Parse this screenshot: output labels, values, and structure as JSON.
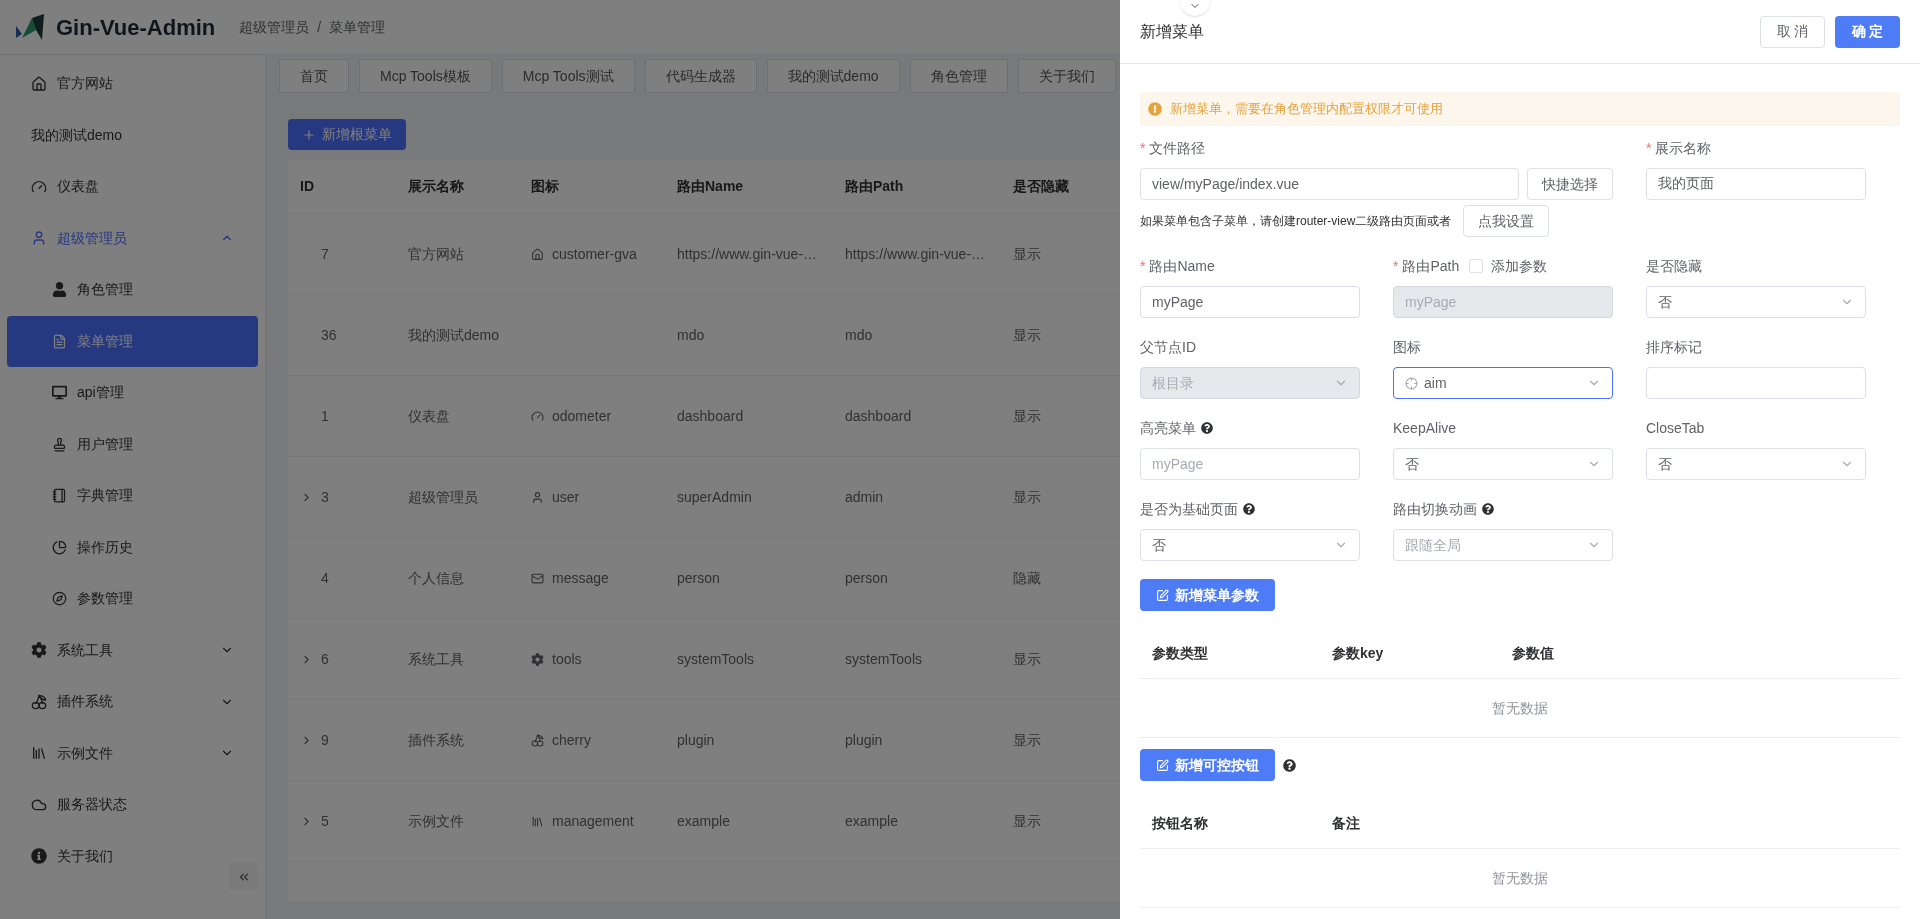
{
  "header": {
    "logo_text": "Gin-Vue-Admin",
    "breadcrumb": [
      "超级管理员",
      "菜单管理"
    ],
    "separator": "/"
  },
  "sidebar": {
    "items": [
      {
        "label": "官方网站",
        "selected": false
      },
      {
        "label": "我的测试demo",
        "selected": false
      },
      {
        "label": "仪表盘",
        "selected": false
      },
      {
        "label": "超级管理员",
        "selected": false,
        "expanded": true,
        "children": [
          {
            "label": "角色管理",
            "selected": false
          },
          {
            "label": "菜单管理",
            "selected": true
          },
          {
            "label": "api管理",
            "selected": false
          },
          {
            "label": "用户管理",
            "selected": false
          },
          {
            "label": "字典管理",
            "selected": false
          },
          {
            "label": "操作历史",
            "selected": false
          },
          {
            "label": "参数管理",
            "selected": false
          }
        ]
      },
      {
        "label": "系统工具",
        "selected": false,
        "expanded": false
      },
      {
        "label": "插件系统",
        "selected": false,
        "expanded": false
      },
      {
        "label": "示例文件",
        "selected": false,
        "expanded": false
      },
      {
        "label": "服务器状态",
        "selected": false
      },
      {
        "label": "关于我们",
        "selected": false
      }
    ]
  },
  "tabs": [
    {
      "label": "首页",
      "selected": false
    },
    {
      "label": "Mcp Tools模板",
      "selected": false
    },
    {
      "label": "Mcp Tools测试",
      "selected": false
    },
    {
      "label": "代码生成器",
      "selected": false
    },
    {
      "label": "我的测试demo",
      "selected": false
    },
    {
      "label": "角色管理",
      "selected": false
    },
    {
      "label": "关于我们",
      "selected": false
    }
  ],
  "add_root_button": "新增根菜单",
  "table": {
    "columns": [
      "ID",
      "展示名称",
      "图标",
      "路由Name",
      "路由Path",
      "是否隐藏"
    ],
    "rows": [
      {
        "has_children": false,
        "id": "7",
        "name": "官方网站",
        "icon_name": "customer-gva",
        "route_name": "https://www.gin-vue-…",
        "route_path": "https://www.gin-vue-…",
        "hidden": "显示"
      },
      {
        "has_children": false,
        "id": "36",
        "name": "我的测试demo",
        "route_name": "mdo",
        "route_path": "mdo",
        "hidden": "显示"
      },
      {
        "has_children": false,
        "id": "1",
        "name": "仪表盘",
        "icon_name": "odometer",
        "route_name": "dashboard",
        "route_path": "dashboard",
        "hidden": "显示"
      },
      {
        "has_children": true,
        "id": "3",
        "name": "超级管理员",
        "icon_name": "user",
        "route_name": "superAdmin",
        "route_path": "admin",
        "hidden": "显示"
      },
      {
        "has_children": false,
        "id": "4",
        "name": "个人信息",
        "icon_name": "message",
        "route_name": "person",
        "route_path": "person",
        "hidden": "隐藏"
      },
      {
        "has_children": true,
        "id": "6",
        "name": "系统工具",
        "icon_name": "tools",
        "route_name": "systemTools",
        "route_path": "systemTools",
        "hidden": "显示"
      },
      {
        "has_children": true,
        "id": "9",
        "name": "插件系统",
        "icon_name": "cherry",
        "route_name": "plugin",
        "route_path": "plugin",
        "hidden": "显示"
      },
      {
        "has_children": true,
        "id": "5",
        "name": "示例文件",
        "icon_name": "management",
        "route_name": "example",
        "route_path": "example",
        "hidden": "显示"
      }
    ]
  },
  "drawer": {
    "title": "新增菜单",
    "required_mark": "*",
    "cancel": "取 消",
    "confirm": "确 定",
    "alert": "新增菜单，需要在角色管理内配置权限才可使用",
    "file_path": {
      "label": "文件路径",
      "required": true,
      "value": "view/myPage/index.vue",
      "button": "快捷选择",
      "hint": "如果菜单包含子菜单，请创建router-view二级路由页面或者",
      "hint_button": "点我设置"
    },
    "display_name": {
      "label": "展示名称",
      "required": true,
      "value": "我的页面"
    },
    "fields": [
      {
        "kind": "input",
        "label": "路由Name",
        "required": true,
        "help": false,
        "disabled": false,
        "focused": false,
        "value": "myPage"
      },
      {
        "kind": "input",
        "label": "路由Path",
        "required": true,
        "help": false,
        "disabled": true,
        "focused": false,
        "value": "myPage",
        "checkbox": {
          "label": "添加参数",
          "checked": false
        }
      },
      {
        "kind": "select",
        "label": "是否隐藏",
        "required": false,
        "help": false,
        "disabled": false,
        "focused": false,
        "value": "否"
      },
      {
        "kind": "select",
        "label": "父节点ID",
        "required": false,
        "help": false,
        "disabled": true,
        "focused": false,
        "value": "根目录"
      },
      {
        "kind": "icon_select",
        "label": "图标",
        "required": false,
        "help": false,
        "disabled": false,
        "focused": true,
        "value": "aim"
      },
      {
        "kind": "input",
        "label": "排序标记",
        "required": false,
        "help": false,
        "disabled": false,
        "focused": false
      },
      {
        "kind": "input",
        "label": "高亮菜单",
        "required": false,
        "help": true,
        "disabled": false,
        "focused": false,
        "placeholder": "myPage"
      },
      {
        "kind": "select",
        "label": "KeepAlive",
        "required": false,
        "help": false,
        "disabled": false,
        "focused": false,
        "value": "否"
      },
      {
        "kind": "select",
        "label": "CloseTab",
        "required": false,
        "help": false,
        "disabled": false,
        "focused": false,
        "value": "否"
      },
      {
        "kind": "select",
        "label": "是否为基础页面",
        "required": false,
        "help": true,
        "disabled": false,
        "focused": false,
        "value": "否"
      },
      {
        "kind": "select",
        "label": "路由切换动画",
        "required": false,
        "help": true,
        "disabled": false,
        "focused": false,
        "placeholder": "跟随全局"
      }
    ],
    "params": {
      "button": "新增菜单参数",
      "help": false,
      "columns": [
        "参数类型",
        "参数key",
        "参数值"
      ],
      "empty": "暂无数据"
    },
    "buttons": {
      "button": "新增可控按钮",
      "help": true,
      "columns": [
        "按钮名称",
        "备注"
      ],
      "empty": "暂无数据"
    }
  }
}
